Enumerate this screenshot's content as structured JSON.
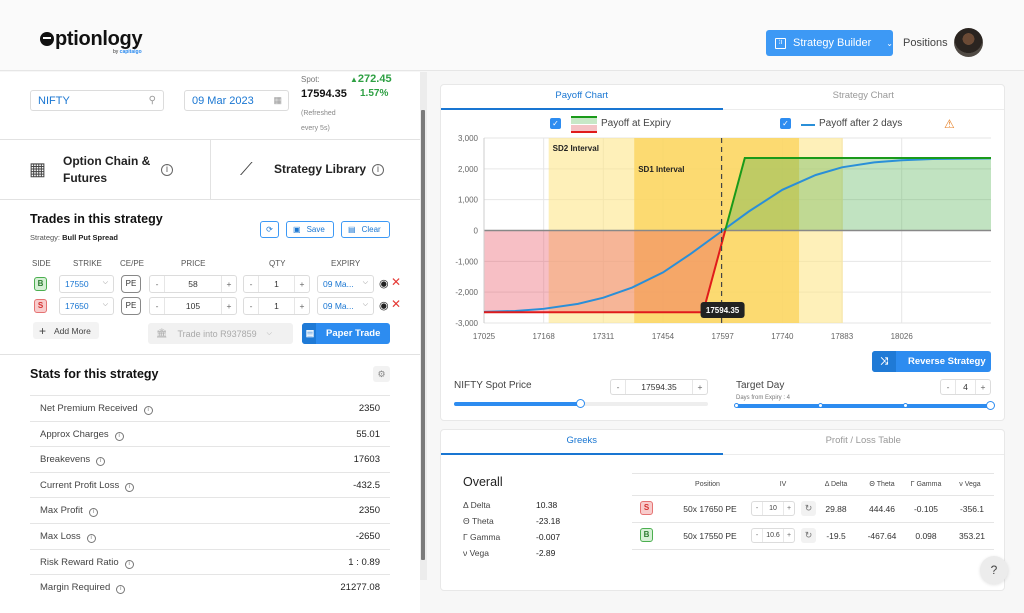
{
  "header": {
    "logo_text": "ptionlogy",
    "logo_sub_prefix": "by ",
    "logo_sub_brand": "capitalgo",
    "strategy_builder_label": "Strategy Builder",
    "positions_label": "Positions"
  },
  "market": {
    "symbol": "NIFTY",
    "expiry_date": "09 Mar 2023",
    "spot_label": "Spot:",
    "spot_value": "17594.35",
    "refresh_note": "(Refreshed every 5s)",
    "change": "272.45",
    "change_pct": "1.57%",
    "change_color": "#2ea043"
  },
  "tiles": [
    {
      "label": "Option Chain & Futures",
      "icon": "grid-icon"
    },
    {
      "label": "Strategy Library",
      "icon": "line-chart-icon"
    }
  ],
  "trades": {
    "title": "Trades in this strategy",
    "strategy_prefix": "Strategy: ",
    "strategy_name": "Bull Put Spread",
    "save_label": "Save",
    "clear_label": "Clear",
    "columns": [
      "SIDE",
      "STRIKE",
      "CE/PE",
      "PRICE",
      "QTY",
      "EXPIRY"
    ],
    "rows": [
      {
        "side": "B",
        "strike": "17550",
        "type": "PE",
        "price": "58",
        "qty": "1",
        "expiry": "09 Ma..."
      },
      {
        "side": "S",
        "strike": "17650",
        "type": "PE",
        "price": "105",
        "qty": "1",
        "expiry": "09 Ma..."
      }
    ],
    "add_more_label": "Add More",
    "trade_into_label": "Trade into R937859",
    "paper_trade_label": "Paper Trade",
    "minus": "-",
    "plus": "+"
  },
  "stats": {
    "title": "Stats for this strategy",
    "rows": [
      {
        "label": "Net Premium Received",
        "value": "2350"
      },
      {
        "label": "Approx Charges",
        "value": "55.01"
      },
      {
        "label": "Breakevens",
        "value": "17603"
      },
      {
        "label": "Current Profit Loss",
        "value": "-432.5"
      },
      {
        "label": "Max Profit",
        "value": "2350"
      },
      {
        "label": "Max Loss",
        "value": "-2650"
      },
      {
        "label": "Risk Reward Ratio",
        "value": "1 : 0.89"
      },
      {
        "label": "Margin Required",
        "value": "21277.08"
      }
    ]
  },
  "chart_tabs": {
    "payoff": "Payoff Chart",
    "strategy": "Strategy Chart"
  },
  "chart_data": {
    "type": "line",
    "legend": [
      "Payoff at Expiry",
      "Payoff after 2 days"
    ],
    "legend_placement": "top",
    "x_ticks": [
      "17025",
      "17168",
      "17311",
      "17454",
      "17597",
      "17740",
      "17883",
      "18026"
    ],
    "y_ticks": [
      "3,000",
      "2,000",
      "1,000",
      "0",
      "-1,000",
      "-2,000",
      "-3,000"
    ],
    "xlim": [
      17025,
      18240
    ],
    "ylim": [
      -3000,
      3000
    ],
    "grid": true,
    "spot": 17594.35,
    "spot_label": "17594.35",
    "bands": [
      {
        "name": "SD2 Interval",
        "from": 17180,
        "to": 17885,
        "color": "#fde68a"
      },
      {
        "name": "SD1 Interval",
        "from": 17385,
        "to": 17780,
        "color": "#fbd35a"
      }
    ],
    "series": [
      {
        "name": "Payoff at Expiry",
        "color_profit": "#1a9a1a",
        "color_loss": "#e01b1b",
        "x": [
          17025,
          17550,
          17650,
          18240
        ],
        "y": [
          -2650,
          -2650,
          2350,
          2350
        ]
      },
      {
        "name": "Payoff after 2 days",
        "color": "#2a8fd8",
        "x": [
          17025,
          17100,
          17168,
          17250,
          17311,
          17380,
          17454,
          17520,
          17597,
          17660,
          17740,
          17820,
          17883,
          17960,
          18026,
          18100,
          18240
        ],
        "y": [
          -2640,
          -2610,
          -2540,
          -2380,
          -2180,
          -1850,
          -1360,
          -760,
          0,
          620,
          1320,
          1800,
          2050,
          2210,
          2280,
          2320,
          2340
        ]
      }
    ]
  },
  "controls": {
    "reverse_label": "Reverse Strategy",
    "spot_label": "NIFTY Spot Price",
    "spot_value": "17594.35",
    "spot_slider_pct": 0.5,
    "target_day_label": "Target Day",
    "target_day_value": "4",
    "days_from_expiry": "Days from Expiry : 4",
    "target_slider_pct": 1.0
  },
  "greeks_tabs": {
    "greeks": "Greeks",
    "pl_table": "Profit / Loss Table"
  },
  "greeks": {
    "overall_title": "Overall",
    "overall": [
      {
        "label": "Δ Delta",
        "value": "10.38"
      },
      {
        "label": "Θ Theta",
        "value": "-23.18"
      },
      {
        "label": "Γ Gamma",
        "value": "-0.007"
      },
      {
        "label": "ν Vega",
        "value": "-2.89"
      }
    ],
    "columns": [
      "Position",
      "IV",
      "Δ Delta",
      "Θ Theta",
      "Γ Gamma",
      "ν Vega"
    ],
    "rows": [
      {
        "side": "S",
        "position": "50x 17650 PE",
        "iv": "10",
        "delta": "29.88",
        "theta": "444.46",
        "gamma": "-0.105",
        "vega": "-356.1"
      },
      {
        "side": "B",
        "position": "50x 17550 PE",
        "iv": "10.6",
        "delta": "-19.5",
        "theta": "-467.64",
        "gamma": "0.098",
        "vega": "353.21"
      }
    ]
  },
  "help_label": "?"
}
